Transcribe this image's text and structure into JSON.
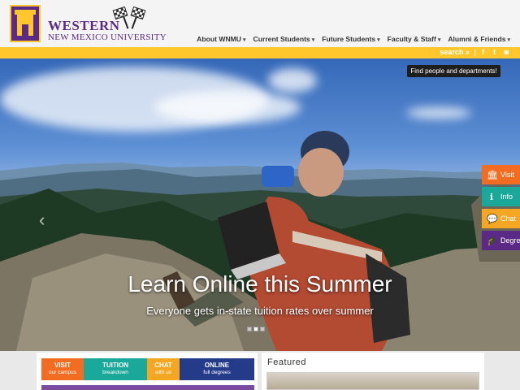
{
  "header": {
    "wordmark_line1": "WESTERN",
    "wordmark_line2": "NEW MEXICO UNIVERSITY",
    "nav": [
      {
        "label": "About WNMU"
      },
      {
        "label": "Current Students"
      },
      {
        "label": "Future Students"
      },
      {
        "label": "Faculty & Staff"
      },
      {
        "label": "Alumni & Friends"
      }
    ]
  },
  "utility": {
    "search_label": "search",
    "social_icons": [
      "facebook-icon",
      "twitter-icon",
      "instagram-icon"
    ],
    "tooltip": "Find people and departments!"
  },
  "hero": {
    "title": "Learn Online this Summer",
    "subtitle": "Everyone gets in-state tuition rates over summer",
    "slide_count": 3,
    "active_slide": 1
  },
  "side_tabs": [
    {
      "label": "Visit",
      "icon": "building-icon",
      "color": "#f26d21"
    },
    {
      "label": "Info",
      "icon": "info-icon",
      "color": "#1aa89a"
    },
    {
      "label": "Chat",
      "icon": "chat-icon",
      "color": "#f5a623"
    },
    {
      "label": "Degrees",
      "icon": "graduation-cap-icon",
      "color": "#5b2a86"
    }
  ],
  "quick_links": [
    {
      "title": "VISIT",
      "sub": "our campus",
      "color": "#f26d21"
    },
    {
      "title": "TUITION",
      "sub": "breakdown",
      "color": "#1aa89a"
    },
    {
      "title": "CHAT",
      "sub": "with us",
      "color": "#f5a623"
    },
    {
      "title": "ONLINE",
      "sub": "full degrees",
      "color": "#243b8a"
    }
  ],
  "featured": {
    "heading": "Featured"
  },
  "colors": {
    "brand_purple": "#5b2a86",
    "brand_gold": "#ffc72c"
  }
}
